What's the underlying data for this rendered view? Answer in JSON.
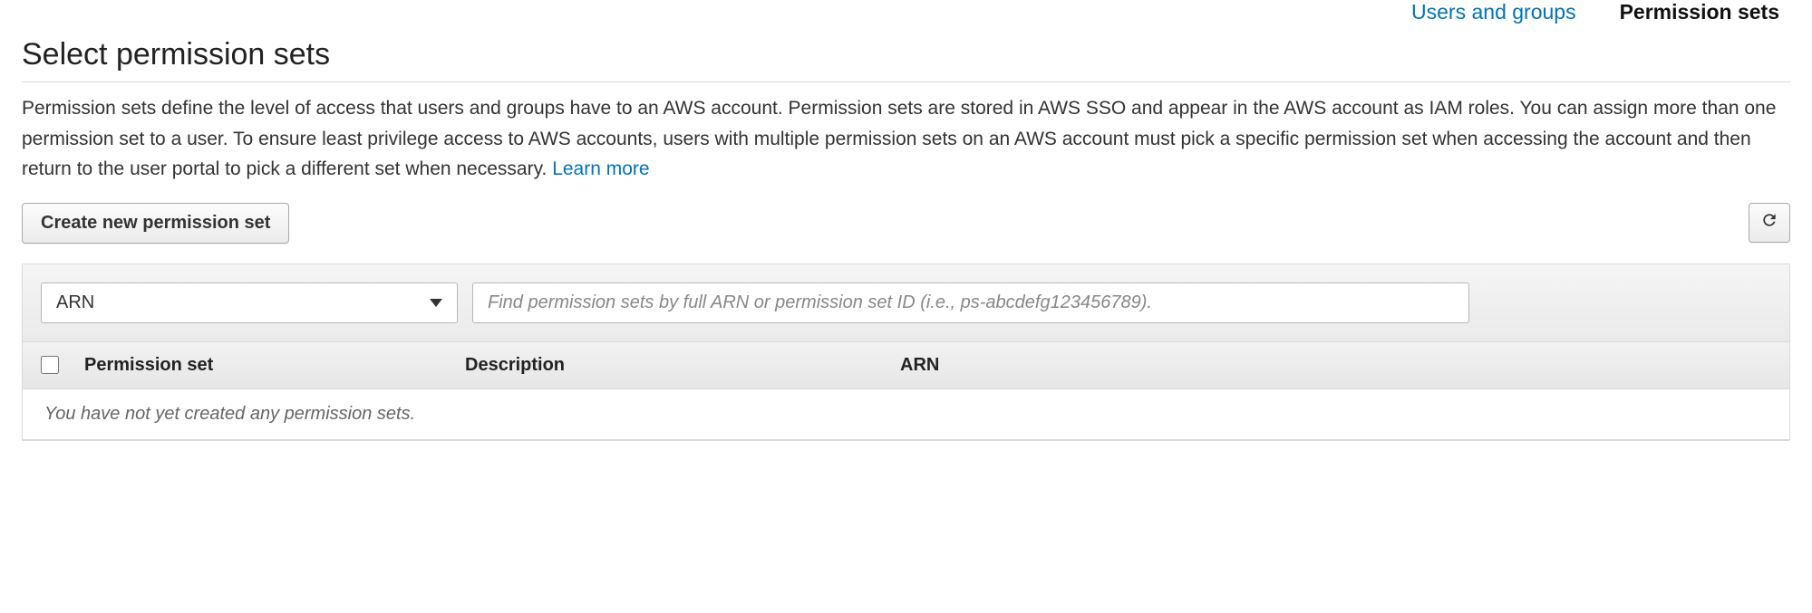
{
  "tabs": {
    "users_groups": "Users and groups",
    "permission_sets": "Permission sets"
  },
  "header": {
    "title": "Select permission sets",
    "description": "Permission sets define the level of access that users and groups have to an AWS account. Permission sets are stored in AWS SSO and appear in the AWS account as IAM roles. You can assign more than one permission set to a user. To ensure least privilege access to AWS accounts, users with multiple permission sets on an AWS account must pick a specific permission set when accessing the account and then return to the user portal to pick a different set when necessary. ",
    "learn_more": "Learn more"
  },
  "toolbar": {
    "create_label": "Create new permission set"
  },
  "filter": {
    "select_value": "ARN",
    "search_placeholder": "Find permission sets by full ARN or permission set ID (i.e., ps-abcdefg123456789)."
  },
  "table": {
    "columns": {
      "permission_set": "Permission set",
      "description": "Description",
      "arn": "ARN"
    },
    "empty_message": "You have not yet created any permission sets."
  }
}
